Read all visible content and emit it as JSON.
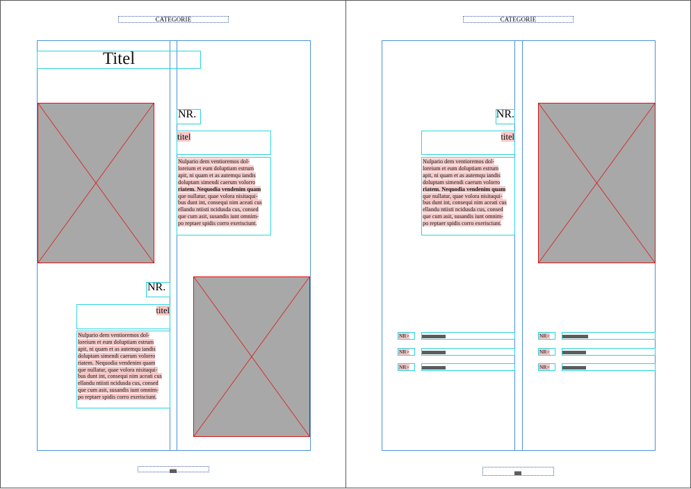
{
  "left_page": {
    "header": "CATEGORIE",
    "title": "Titel",
    "articles": [
      {
        "nr": "NR.",
        "subtitle": "titel",
        "body": [
          {
            "text": "Nulpario dem ventioremos dol-",
            "bold": false
          },
          {
            "text": "loreium et eum doluptiam estrum",
            "bold": false
          },
          {
            "text": "apit, ni quam et as autemqu iandis",
            "bold": false
          },
          {
            "text": "doluptam simendi caerum volorro",
            "bold": false
          },
          {
            "text": "riatem. Nequodia vendenim quam",
            "bold": true
          },
          {
            "text": "que nullatur, quae volora nisitaqui-",
            "bold": false
          },
          {
            "text": "bus dunt int, consequi nim aceati cus",
            "bold": false
          },
          {
            "text": "ellandu ntiisti ncidusda cus, consed",
            "bold": false
          },
          {
            "text": "que cum asit, susandis iunt omnim-",
            "bold": false
          },
          {
            "text": "po reptaer spidis corro exerisciunt.",
            "bold": false
          }
        ]
      },
      {
        "nr": "NR.",
        "subtitle": "titel",
        "body": [
          {
            "text": "Nulpario dem ventioremos dol-",
            "bold": false
          },
          {
            "text": "loreium et eum doluptiam estrum",
            "bold": false
          },
          {
            "text": "apit, ni quam et as autemqu iandis",
            "bold": false
          },
          {
            "text": "doluptam simendi caerum volorro",
            "bold": false
          },
          {
            "text": "riatem. Nequodia vendenim quam",
            "bold": false
          },
          {
            "text": "que nullatur, quae volora nisitaqui-",
            "bold": false
          },
          {
            "text": "bus dunt int, consequi nim aceati cus",
            "bold": false
          },
          {
            "text": "ellandu ntiisti ncidusda cus, consed",
            "bold": false
          },
          {
            "text": "que cum asit, susandis iunt omnim-",
            "bold": false
          },
          {
            "text": "po reptaer spidis corro exerisciunt.",
            "bold": false
          }
        ]
      }
    ]
  },
  "right_page": {
    "header": "CATEGORIE",
    "article": {
      "nr": "NR.",
      "subtitle": "titel",
      "body": [
        {
          "text": "Nulpario dem ventioremos dol-",
          "bold": false
        },
        {
          "text": "loreium et eum doluptiam estrum",
          "bold": false
        },
        {
          "text": "apit, ni quam et as autemqu iandis",
          "bold": false
        },
        {
          "text": "doluptam simendi caerum volorro",
          "bold": false
        },
        {
          "text": "riatem. Nequodia vendenim quam",
          "bold": true
        },
        {
          "text": "que nullatur, quae volora nisitaqui-",
          "bold": false
        },
        {
          "text": "bus dunt int, consequi nim aceati cus",
          "bold": false
        },
        {
          "text": "ellandu ntiisti ncidusda cus, consed",
          "bold": false
        },
        {
          "text": "que cum asit, susandis iunt omnim-",
          "bold": false
        },
        {
          "text": "po reptaer spidis corro exerisciunt.",
          "bold": false
        }
      ]
    },
    "list_label": "NR>"
  },
  "colors": {
    "margin_guide": "#4a90d9",
    "text_frame": "#2ad3e0",
    "placeholder_fill": "#a8a8a8",
    "placeholder_cross": "#dd1111",
    "text_highlight": "#f6c9c9"
  }
}
